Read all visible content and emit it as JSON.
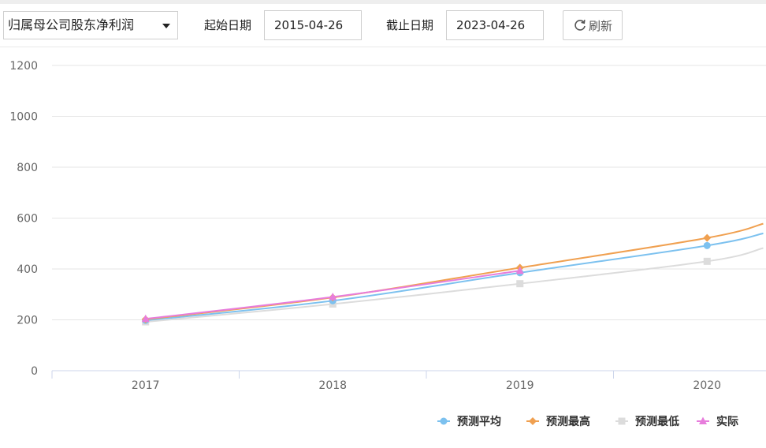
{
  "toolbar": {
    "metric_select": {
      "value": "归属母公司股东净利润"
    },
    "start_label": "起始日期",
    "start_date": "2015-04-26",
    "end_label": "截止日期",
    "end_date": "2023-04-26",
    "refresh_label": "刷新"
  },
  "colors": {
    "avg": "#7cc1ef",
    "high": "#f0a050",
    "low": "#dcdcdc",
    "actual": "#e77ddc",
    "grid": "#e6e6e6",
    "axis": "#ccd6eb"
  },
  "chart_data": {
    "type": "line",
    "categories": [
      "2017",
      "2018",
      "2019",
      "2020"
    ],
    "ylim": [
      0,
      1200
    ],
    "yticks": [
      0,
      200,
      400,
      600,
      800,
      1000,
      1200
    ],
    "grid": true,
    "legend_position": "bottom-right",
    "series": [
      {
        "name": "预测平均",
        "marker": "circle",
        "color": "#7cc1ef",
        "x": [
          0,
          1,
          2,
          3,
          3.3
        ],
        "values": [
          198,
          275,
          385,
          492,
          540
        ]
      },
      {
        "name": "预测最高",
        "marker": "diamond",
        "color": "#f0a050",
        "x": [
          0,
          1,
          2,
          3,
          3.3
        ],
        "values": [
          202,
          288,
          405,
          522,
          578
        ]
      },
      {
        "name": "预测最低",
        "marker": "square",
        "color": "#dcdcdc",
        "x": [
          0,
          1,
          2,
          3,
          3.3
        ],
        "values": [
          192,
          262,
          342,
          430,
          482
        ]
      },
      {
        "name": "实际",
        "marker": "triangle",
        "color": "#e77ddc",
        "x": [
          0,
          1,
          2
        ],
        "values": [
          204,
          290,
          393
        ]
      }
    ]
  }
}
